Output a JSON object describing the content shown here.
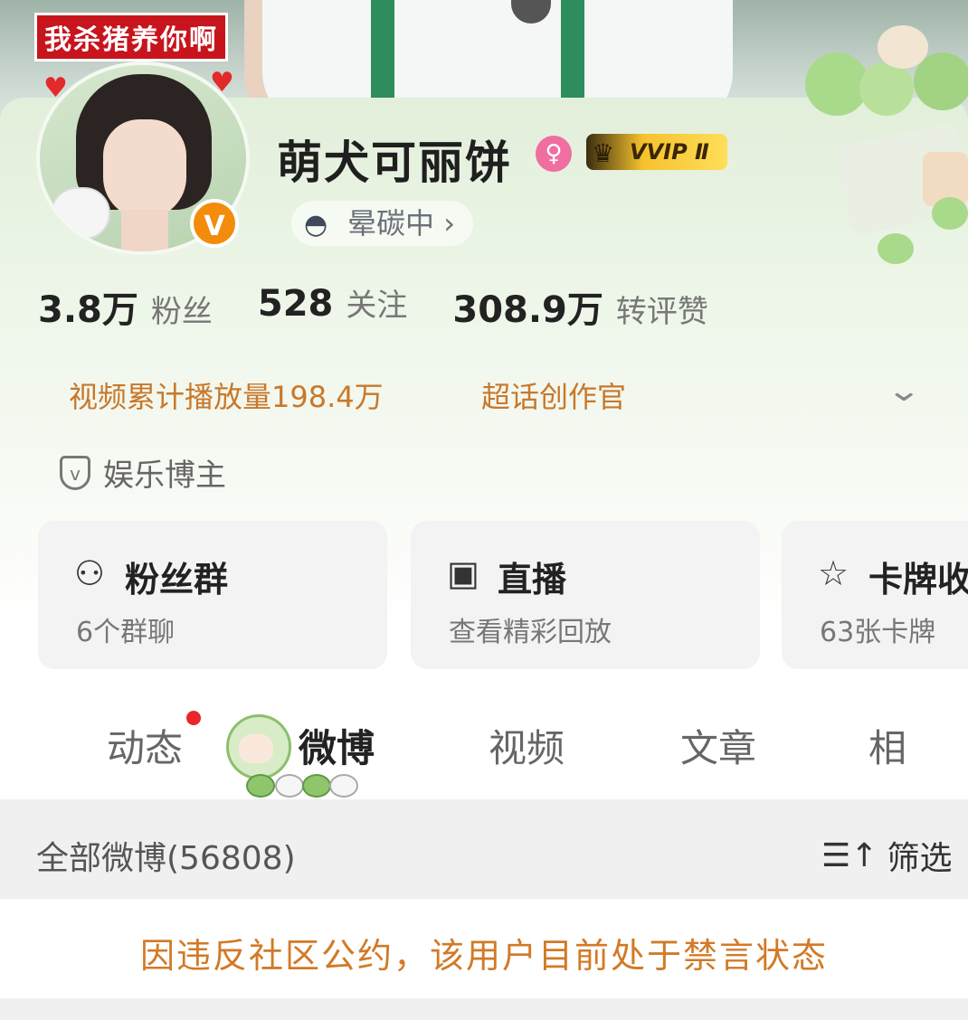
{
  "banner": {
    "caption": "我杀猪养你啊"
  },
  "profile": {
    "username": "萌犬可丽饼",
    "vip_label": "VVIP Ⅱ",
    "verified_badge": "V",
    "gender_icon": "female-icon",
    "status": "晕碳中",
    "status_arrow": "›"
  },
  "stats": [
    {
      "value": "3.8万",
      "label": "粉丝"
    },
    {
      "value": "528",
      "label": "关注"
    },
    {
      "value": "308.9万",
      "label": "转评赞"
    }
  ],
  "tags": {
    "plays": "视频累计播放量198.4万",
    "role": "超话创作官"
  },
  "category": {
    "label": "娱乐博主"
  },
  "tiles": [
    {
      "title": "粉丝群",
      "subtitle": "6个群聊",
      "icon": "users-icon"
    },
    {
      "title": "直播",
      "subtitle": "查看精彩回放",
      "icon": "tv-icon"
    },
    {
      "title": "卡牌收",
      "subtitle": "63张卡牌",
      "icon": "card-icon"
    }
  ],
  "tabs": [
    "动态",
    "微博",
    "视频",
    "文章",
    "相"
  ],
  "filter": {
    "all_label": "全部微博(56808)",
    "filter_label": "筛选"
  },
  "notice": "因违反社区公约，该用户目前处于禁言状态",
  "colors": {
    "tag_orange": "#c9782a",
    "notice_orange": "#d27a26",
    "badge_orange": "#f28c0a",
    "red_dot": "#e8262b"
  }
}
